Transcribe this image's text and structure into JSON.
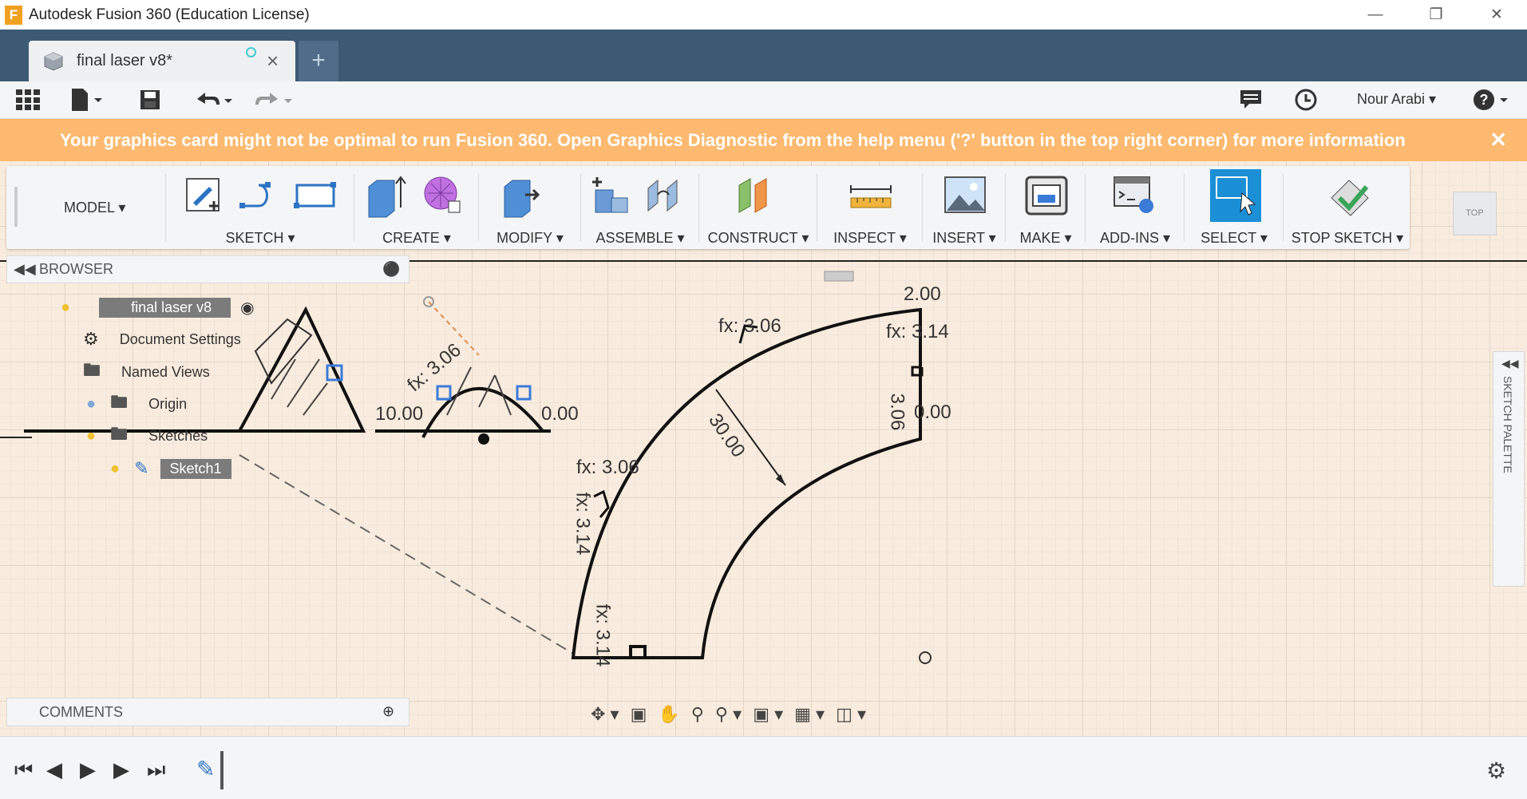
{
  "window": {
    "title": "Autodesk Fusion 360 (Education License)",
    "app_initial": "F"
  },
  "tab": {
    "name": "final laser v8*",
    "new_tab": "+"
  },
  "qat": {
    "user": "Nour Arabi"
  },
  "banner": {
    "message": "Your graphics card might not be optimal to run Fusion 360. Open Graphics Diagnostic from the help menu ('?' button in the top right corner) for more information",
    "close": "✕"
  },
  "toolbar": {
    "workspace": "MODEL",
    "groups": [
      "SKETCH",
      "CREATE",
      "MODIFY",
      "ASSEMBLE",
      "CONSTRUCT",
      "INSPECT",
      "INSERT",
      "MAKE",
      "ADD-INS",
      "SELECT",
      "STOP SKETCH"
    ]
  },
  "viewcube": {
    "label": "TOP"
  },
  "browser": {
    "title": "BROWSER",
    "root": "final laser v8",
    "items": [
      "Document Settings",
      "Named Views",
      "Origin",
      "Sketches",
      "Sketch1"
    ]
  },
  "comments": {
    "title": "COMMENTS"
  },
  "palette": {
    "title": "SKETCH PALETTE"
  },
  "dims": {
    "d1": "fx: 3.06",
    "d2": "2.00",
    "d3": "fx: 3.14",
    "d4": "30.00",
    "d5": "fx: 3.06",
    "d6": "fx: 3.14",
    "d7": "fx: 3.14",
    "d8": "3.06",
    "d9": "0.00",
    "d10": "10.00",
    "d11": "fx: 3.06",
    "d12": "0.00"
  },
  "colors": {
    "tabbar": "#3d5a75",
    "banner": "#fcb96f",
    "select": "#1a8fd6",
    "canvas": "#f9ecde"
  }
}
